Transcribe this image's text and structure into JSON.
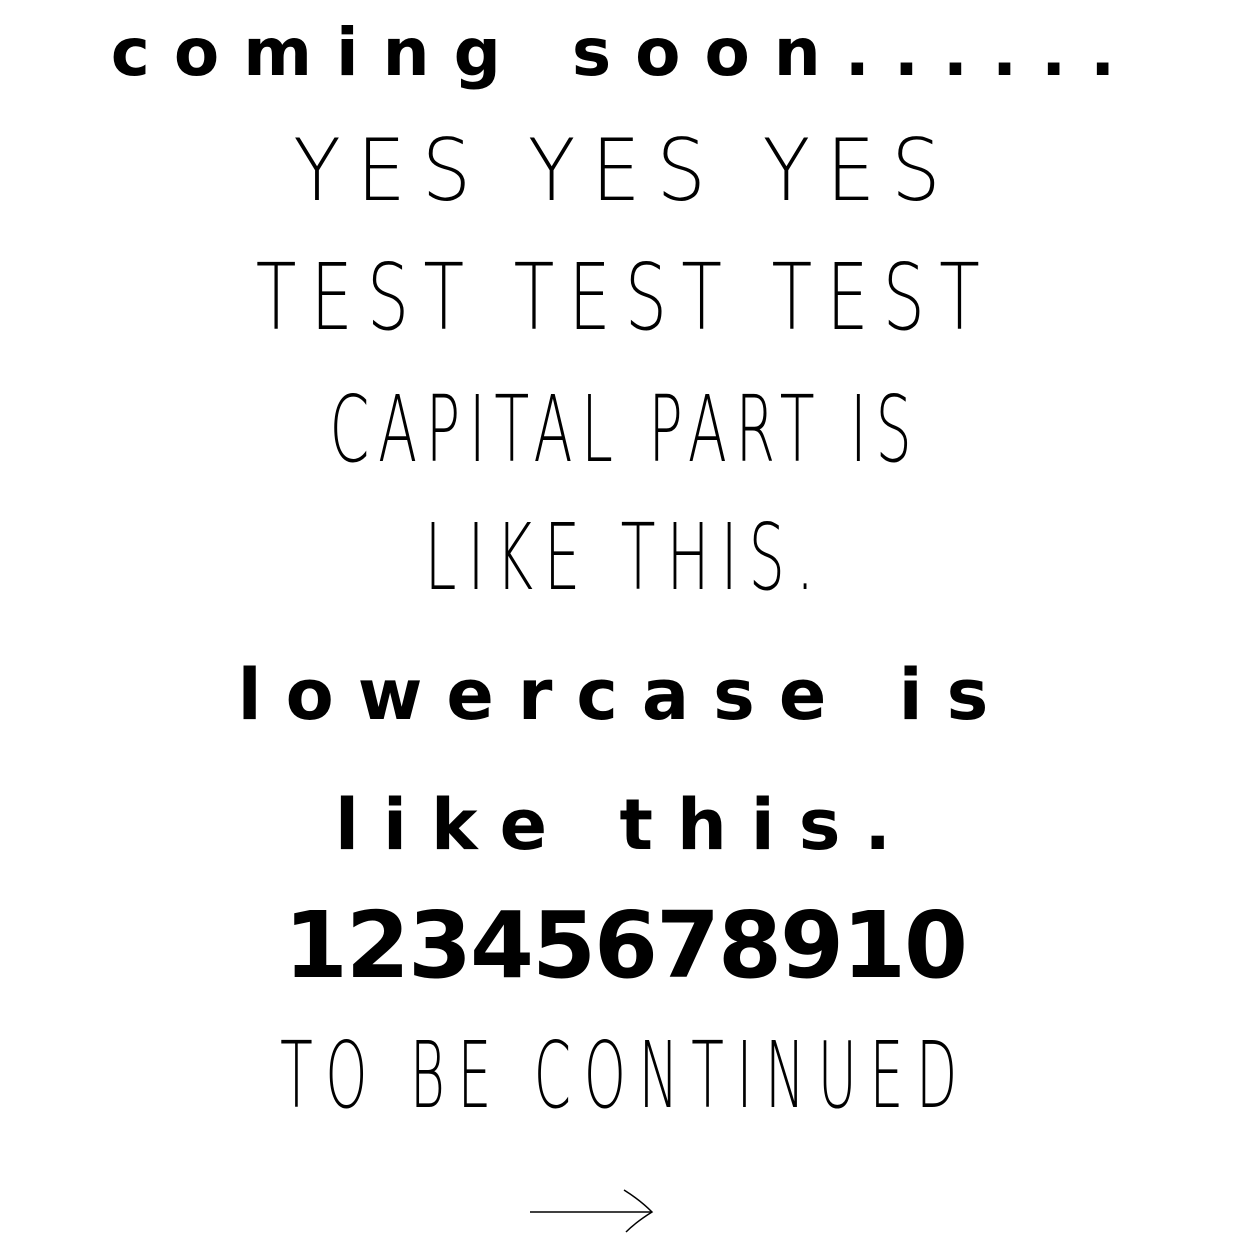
{
  "lines": {
    "coming_soon": "coming Soon......",
    "yes": "YES YES YES",
    "test": "TEST TEST TEST",
    "capital": "CAPITAL PART IS",
    "like_this_caps": "LIKE THIS.",
    "lowercase": "lowercase is",
    "like_this_lower": "like this.",
    "digits": "12345678910",
    "continued": "TO BE CONTINUED"
  },
  "icons": {
    "next": "right-arrow-icon"
  },
  "colors": {
    "background": "#ffffff",
    "ink": "#000000"
  }
}
